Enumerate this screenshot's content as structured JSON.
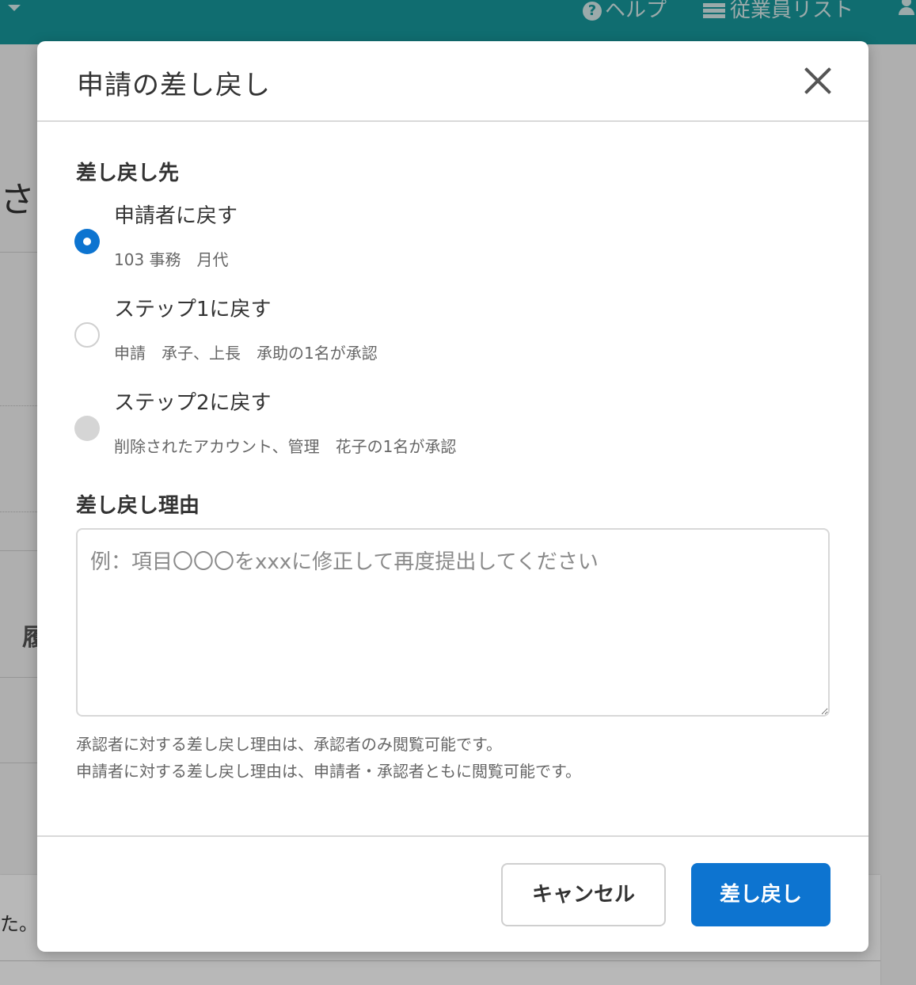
{
  "header": {
    "help_label": "ヘルプ",
    "employee_list_label": "従業員リスト"
  },
  "background": {
    "partial_char_1": "さ",
    "partial_char_2": "履",
    "partial_text": "た。"
  },
  "modal": {
    "title": "申請の差し戻し",
    "destination_label": "差し戻し先",
    "options": [
      {
        "label": "申請者に戻す",
        "sub": "103 事務　月代",
        "state": "checked"
      },
      {
        "label": "ステップ1に戻す",
        "sub": "申請　承子、上長　承助の1名が承認",
        "state": "unchecked"
      },
      {
        "label": "ステップ2に戻す",
        "sub": "削除されたアカウント、管理　花子の1名が承認",
        "state": "disabled"
      }
    ],
    "reason_label": "差し戻し理由",
    "reason_placeholder": "例：項目〇〇〇をxxxに修正して再度提出してください",
    "reason_value": "",
    "notes": [
      "承認者に対する差し戻し理由は、承認者のみ閲覧可能です。",
      "申請者に対する差し戻し理由は、申請者・承認者ともに閲覧可能です。"
    ],
    "cancel_label": "キャンセル",
    "submit_label": "差し戻し"
  },
  "colors": {
    "topbar": "#17979b",
    "primary": "#0d74d0"
  }
}
